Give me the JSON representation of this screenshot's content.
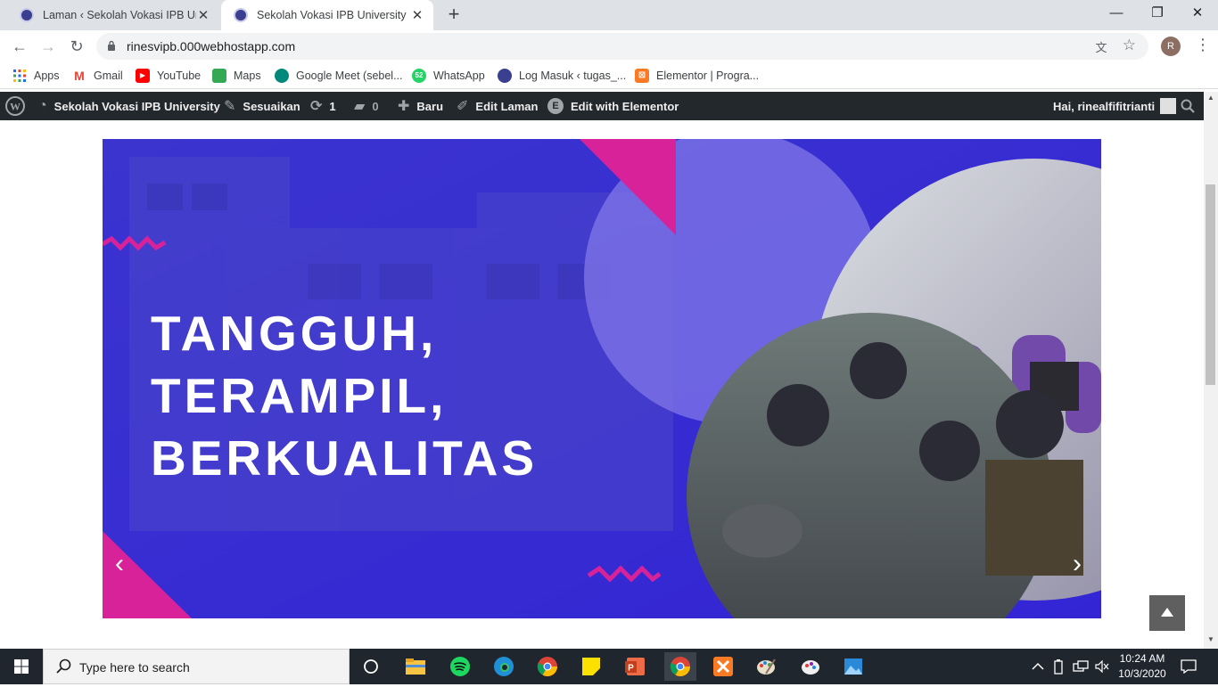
{
  "browser": {
    "tabs": [
      {
        "title": "Laman ‹ Sekolah Vokasi IPB Unive",
        "active": false
      },
      {
        "title": "Sekolah Vokasi IPB University",
        "active": true
      }
    ],
    "new_tab": "+",
    "url": "rinesvipb.000webhostapp.com",
    "profile_initial": "R",
    "bookmarks": [
      {
        "label": "Apps",
        "icon": "apps-grid-icon"
      },
      {
        "label": "Gmail",
        "icon": "gmail-icon"
      },
      {
        "label": "YouTube",
        "icon": "youtube-icon"
      },
      {
        "label": "Maps",
        "icon": "maps-icon"
      },
      {
        "label": "Google Meet (sebel...",
        "icon": "meet-icon"
      },
      {
        "label": "WhatsApp",
        "icon": "whatsapp-icon"
      },
      {
        "label": "Log Masuk ‹ tugas_...",
        "icon": "site-icon"
      },
      {
        "label": "Elementor | Progra...",
        "icon": "xampp-icon"
      }
    ]
  },
  "wp_admin_bar": {
    "site_name": "Sekolah Vokasi IPB University",
    "customize": "Sesuaikan",
    "updates_count": "1",
    "comments_count": "0",
    "new": "Baru",
    "edit_page": "Edit Laman",
    "edit_elementor": "Edit with Elementor",
    "greeting": "Hai, rinealfifitrianti"
  },
  "banner": {
    "headline": [
      "TANGGUH,",
      "TERAMPIL,",
      "BERKUALITAS"
    ],
    "colors": {
      "base": "#3b2dd6",
      "accent": "#d8229a",
      "circle": "#7b6ee6"
    }
  },
  "taskbar": {
    "search_placeholder": "Type here to search",
    "time": "10:24 AM",
    "date": "10/3/2020"
  }
}
